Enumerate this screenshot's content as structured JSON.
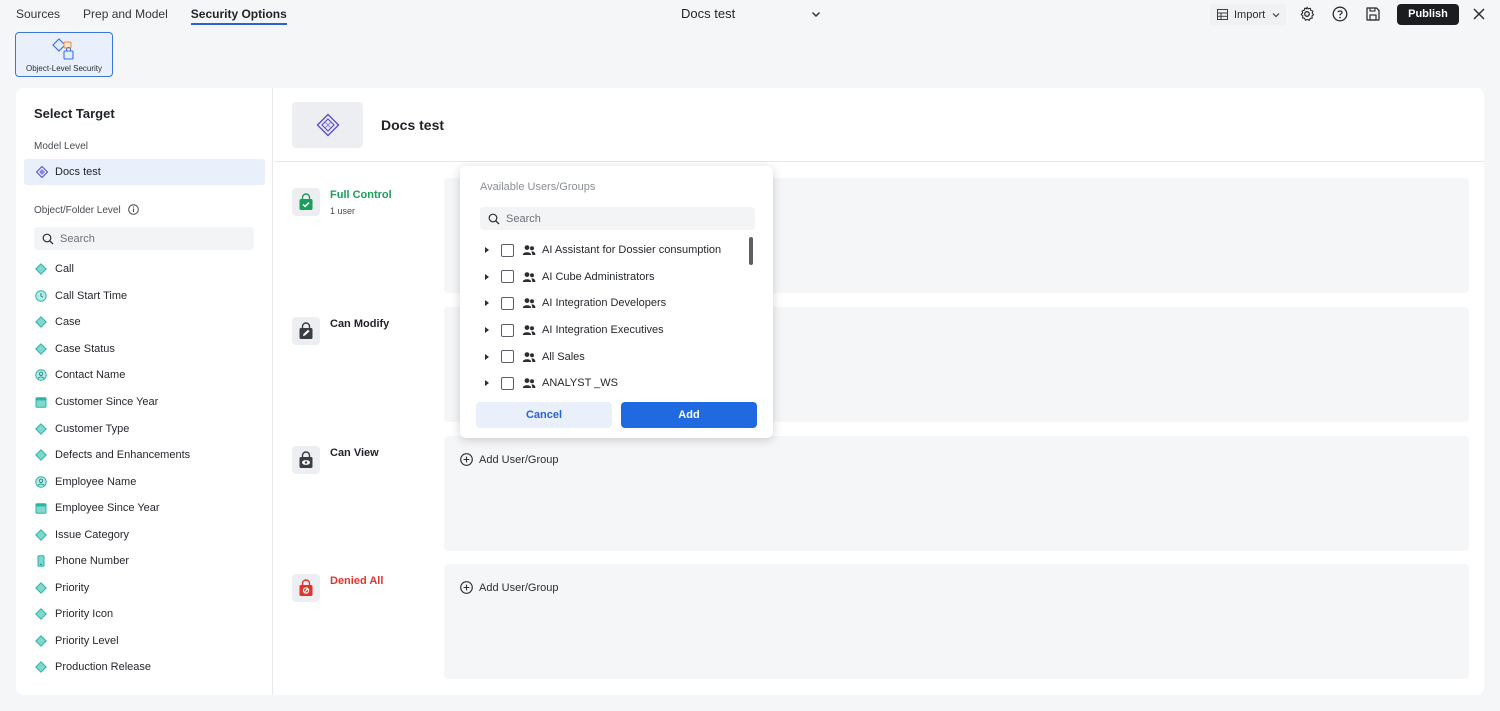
{
  "topbar": {
    "tabs": [
      {
        "label": "Sources",
        "active": false
      },
      {
        "label": "Prep and Model",
        "active": false
      },
      {
        "label": "Security Options",
        "active": true
      }
    ],
    "doc_title": "Docs test",
    "import_label": "Import",
    "publish_label": "Publish"
  },
  "toolbar": {
    "ols_label": "Object-Level Security"
  },
  "left": {
    "select_target": "Select Target",
    "model_level_label": "Model Level",
    "model_item": "Docs test",
    "object_level_label": "Object/Folder Level",
    "search_placeholder": "Search",
    "objects": [
      {
        "label": "Call",
        "icon": "attribute-icon"
      },
      {
        "label": "Call Start Time",
        "icon": "clock-icon"
      },
      {
        "label": "Case",
        "icon": "attribute-icon"
      },
      {
        "label": "Case Status",
        "icon": "attribute-icon"
      },
      {
        "label": "Contact Name",
        "icon": "person-icon"
      },
      {
        "label": "Customer Since Year",
        "icon": "calendar-icon"
      },
      {
        "label": "Customer Type",
        "icon": "attribute-icon"
      },
      {
        "label": "Defects and Enhancements",
        "icon": "attribute-icon"
      },
      {
        "label": "Employee Name",
        "icon": "person-icon"
      },
      {
        "label": "Employee Since Year",
        "icon": "calendar-icon"
      },
      {
        "label": "Issue Category",
        "icon": "attribute-icon"
      },
      {
        "label": "Phone Number",
        "icon": "phone-icon"
      },
      {
        "label": "Priority",
        "icon": "attribute-icon"
      },
      {
        "label": "Priority Icon",
        "icon": "attribute-icon"
      },
      {
        "label": "Priority Level",
        "icon": "attribute-icon"
      },
      {
        "label": "Production Release",
        "icon": "attribute-icon"
      }
    ]
  },
  "right": {
    "model_title": "Docs test",
    "permissions": [
      {
        "title": "Full Control",
        "subtitle": "1 user",
        "color": "#1a9e5a",
        "add_label": ""
      },
      {
        "title": "Can Modify",
        "subtitle": "",
        "color": "#1f2329",
        "add_label": ""
      },
      {
        "title": "Can View",
        "subtitle": "",
        "color": "#1f2329",
        "add_label": "Add User/Group"
      },
      {
        "title": "Denied All",
        "subtitle": "",
        "color": "#e0342c",
        "add_label": "Add User/Group"
      }
    ]
  },
  "popover": {
    "title": "Available Users/Groups",
    "search_placeholder": "Search",
    "items": [
      "AI Assistant for Dossier consumption",
      "AI Cube Administrators",
      "AI Integration Developers",
      "AI Integration Executives",
      "All Sales",
      "ANALYST _WS"
    ],
    "cancel_label": "Cancel",
    "add_label": "Add"
  },
  "colors": {
    "accent": "#1f6ae0",
    "full_control": "#1a9e5a",
    "denied": "#e0342c",
    "attribute": "#2bb3a6"
  }
}
